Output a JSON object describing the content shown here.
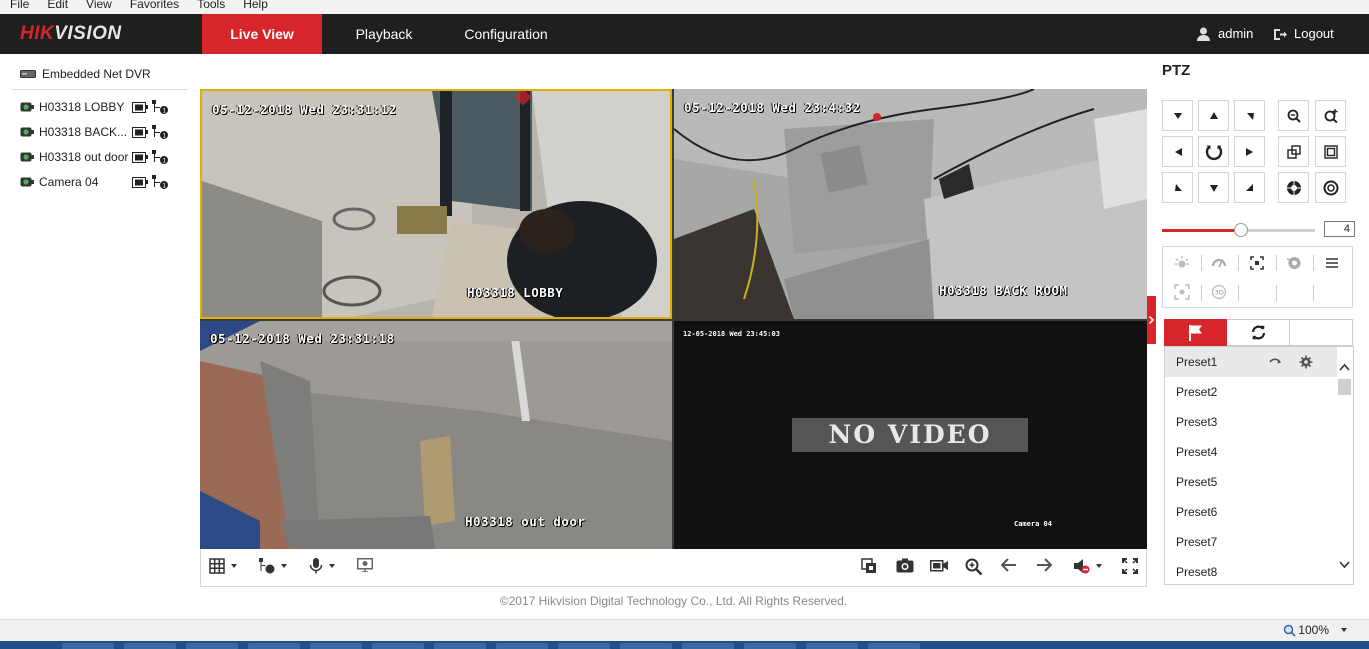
{
  "menubar": {
    "items": [
      "File",
      "Edit",
      "View",
      "Favorites",
      "Tools",
      "Help"
    ]
  },
  "brand": {
    "logo_main": "HIK",
    "logo_rest": "VISION",
    "accent": "#d6252b",
    "nav_bg": "#1f1f1f"
  },
  "nav": {
    "tabs": [
      {
        "label": "Live View",
        "active": true
      },
      {
        "label": "Playback",
        "active": false
      },
      {
        "label": "Configuration",
        "active": false
      }
    ],
    "user": "admin",
    "logout": "Logout"
  },
  "device_tree": {
    "root": "Embedded Net DVR",
    "cameras": [
      {
        "name": "H03318 LOBBY"
      },
      {
        "name": "H03318 BACK..."
      },
      {
        "name": "H03318 out door"
      },
      {
        "name": "Camera 04"
      }
    ]
  },
  "video": {
    "tiles": [
      {
        "timestamp": "05-12-2018 Wed 23:31:12",
        "channel": "H03318 LOBBY",
        "selected": true
      },
      {
        "timestamp": "05-12-2018 Wed 23:4:32",
        "channel": "H03318 BACK ROOM",
        "selected": false
      },
      {
        "timestamp": "05-12-2018 Wed 23:31:18",
        "channel": "H03318 out door",
        "selected": false
      },
      {
        "timestamp": "12-05-2018 Wed 23:45:03",
        "channel": "Camera 04",
        "status": "NO VIDEO",
        "selected": false
      }
    ]
  },
  "toolbar": {
    "left": [
      "window-layout-icon",
      "stream-icon",
      "microphone-icon",
      "channel-zero-icon"
    ],
    "right": [
      "capture-all-icon",
      "snapshot-icon",
      "record-icon",
      "digital-zoom-icon",
      "prev-page-icon",
      "next-page-icon",
      "volume-mute-icon",
      "fullscreen-icon"
    ]
  },
  "footer": {
    "copyright": "©2017 Hikvision Digital Technology Co., Ltd. All Rights Reserved."
  },
  "ptz": {
    "title": "PTZ",
    "speed": "4",
    "speed_level_fraction": 0.45,
    "presets": [
      "Preset1",
      "Preset2",
      "Preset3",
      "Preset4",
      "Preset5",
      "Preset6",
      "Preset7",
      "Preset8"
    ]
  },
  "statusbar": {
    "zoom": "100%"
  }
}
